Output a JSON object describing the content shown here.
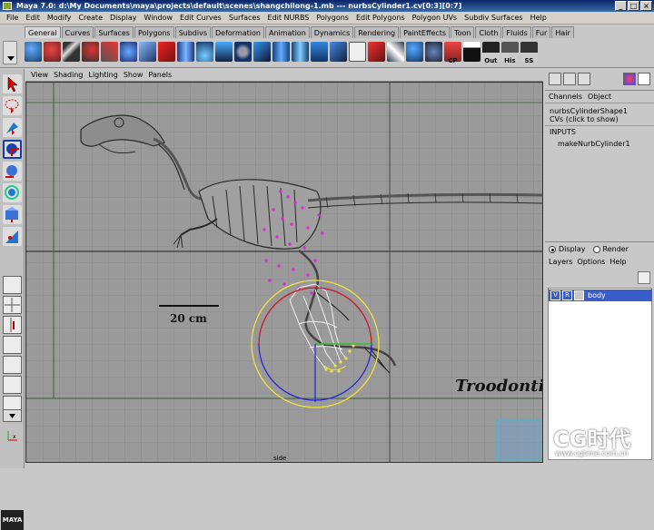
{
  "window": {
    "title": "Maya 7.0: d:\\My Documents\\maya\\projects\\default\\scenes\\shangchilong-1.mb   ---   nurbsCylinder1.cv[0:3][0:7]"
  },
  "menubar": [
    "File",
    "Edit",
    "Modify",
    "Create",
    "Display",
    "Window",
    "Edit Curves",
    "Surfaces",
    "Edit NURBS",
    "Polygons",
    "Edit Polygons",
    "Polygon UVs",
    "Subdiv Surfaces",
    "Help"
  ],
  "shelf": {
    "tabs": [
      "General",
      "Curves",
      "Surfaces",
      "Polygons",
      "Subdivs",
      "Deformation",
      "Animation",
      "Dynamics",
      "Rendering",
      "PaintEffects",
      "Toon",
      "Cloth",
      "Fluids",
      "Fur",
      "Hair"
    ],
    "active_tab": "General",
    "icon_labels": {
      "cp": "CP",
      "out": "Out",
      "his": "His",
      "ss": "SS"
    }
  },
  "viewport": {
    "menu": [
      "View",
      "Shading",
      "Lighting",
      "Show",
      "Panels"
    ],
    "camera_label": "side",
    "scale_bar_label": "20 cm",
    "image_caption": "Troodonti"
  },
  "channel_box": {
    "menu": [
      "Channels",
      "Object"
    ],
    "shape_name": "nurbsCylinderShape1",
    "cvs_label": "CVs (click to show)",
    "inputs_label": "INPUTS",
    "input_node": "makeNurbCylinder1"
  },
  "layer_editor": {
    "radio_display": "Display",
    "radio_render": "Render",
    "selected_radio": "Display",
    "menu": [
      "Layers",
      "Options",
      "Help"
    ],
    "layers": [
      {
        "visible": "V",
        "ref": "R",
        "name": "body"
      }
    ]
  },
  "watermark": {
    "brand": "CG时代",
    "url": "www.cgtime.com.cn"
  }
}
